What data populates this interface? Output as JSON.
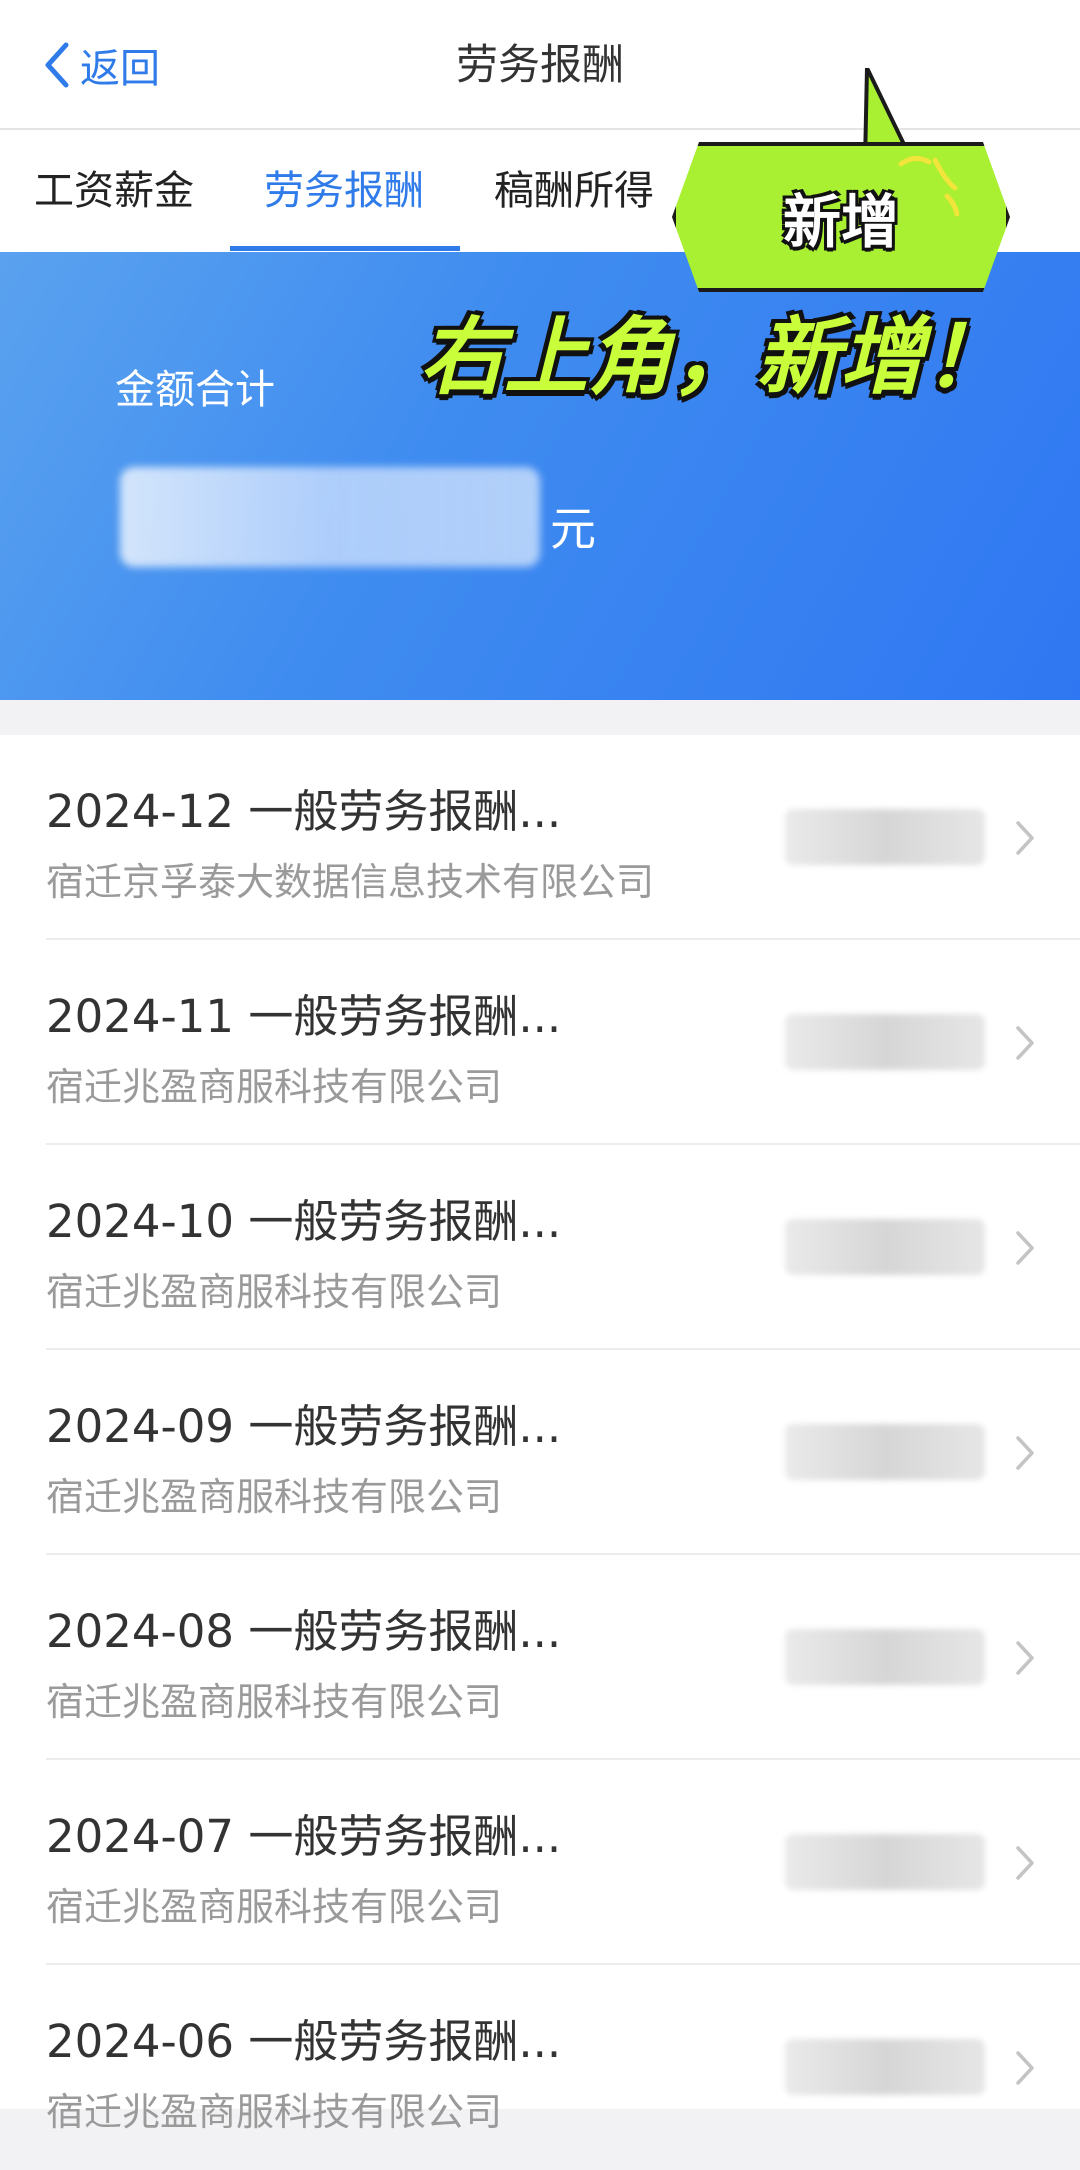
{
  "header": {
    "back_label": "返回",
    "title": "劳务报酬"
  },
  "tabs": [
    {
      "label": "工资薪金"
    },
    {
      "label": "劳务报酬"
    },
    {
      "label": "稿酬所得"
    }
  ],
  "overlay": {
    "callout_text": "新增",
    "caption": "右上角，新增！"
  },
  "summary": {
    "label": "金额合计",
    "unit": "元"
  },
  "records": [
    {
      "title": "2024-12 一般劳务报酬...",
      "company": "宿迁京孚泰大数据信息技术有限公司"
    },
    {
      "title": "2024-11 一般劳务报酬...",
      "company": "宿迁兆盈商服科技有限公司"
    },
    {
      "title": "2024-10 一般劳务报酬...",
      "company": "宿迁兆盈商服科技有限公司"
    },
    {
      "title": "2024-09 一般劳务报酬...",
      "company": "宿迁兆盈商服科技有限公司"
    },
    {
      "title": "2024-08 一般劳务报酬...",
      "company": "宿迁兆盈商服科技有限公司"
    },
    {
      "title": "2024-07 一般劳务报酬...",
      "company": "宿迁兆盈商服科技有限公司"
    },
    {
      "title": "2024-06 一般劳务报酬...",
      "company": "宿迁兆盈商服科技有限公司"
    }
  ],
  "colors": {
    "accent": "#2f7bea",
    "banner": "#3f8cf0",
    "callout": "#a9ef32"
  }
}
